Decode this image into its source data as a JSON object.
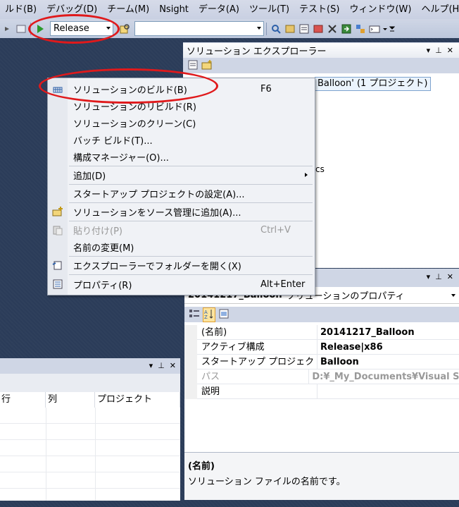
{
  "menubar": {
    "items": [
      "ルド(B)",
      "デバッグ(D)",
      "チーム(M)",
      "Nsight",
      "データ(A)",
      "ツール(T)",
      "テスト(S)",
      "ウィンドウ(W)",
      "ヘルプ(H)"
    ]
  },
  "toolbar": {
    "config_value": "Release",
    "platform_value": ""
  },
  "solution_explorer": {
    "title": "ソリューション エクスプローラー",
    "tree_node": "Balloon' (1 プロジェクト)",
    "tree_fragment": "cs"
  },
  "context_menu": {
    "items": [
      {
        "label": "ソリューションのビルド(B)",
        "shortcut": "F6",
        "icon": "build-icon"
      },
      {
        "label": "ソリューションのリビルド(R)",
        "shortcut": "",
        "icon": ""
      },
      {
        "label": "ソリューションのクリーン(C)",
        "shortcut": "",
        "icon": ""
      },
      {
        "label": "バッチ ビルド(T)...",
        "shortcut": "",
        "icon": ""
      },
      {
        "label": "構成マネージャー(O)...",
        "shortcut": "",
        "icon": ""
      },
      {
        "label": "追加(D)",
        "shortcut": "",
        "icon": ""
      },
      {
        "label": "スタートアップ プロジェクトの設定(A)...",
        "shortcut": "",
        "icon": ""
      },
      {
        "label": "ソリューションをソース管理に追加(A)...",
        "shortcut": "",
        "icon": "source-control-icon"
      },
      {
        "label": "貼り付け(P)",
        "shortcut": "Ctrl+V",
        "icon": "paste-icon"
      },
      {
        "label": "名前の変更(M)",
        "shortcut": "",
        "icon": ""
      },
      {
        "label": "エクスプローラーでフォルダーを開く(X)",
        "shortcut": "",
        "icon": "open-folder-icon"
      },
      {
        "label": "プロパティ(R)",
        "shortcut": "Alt+Enter",
        "icon": "properties-icon"
      }
    ]
  },
  "properties": {
    "object_name": "20141217_Balloon",
    "object_type": "ソリューションのプロパティ",
    "rows": [
      {
        "name": "(名前)",
        "value": "20141217_Balloon"
      },
      {
        "name": "アクティブ構成",
        "value": "Release|x86"
      },
      {
        "name": "スタートアップ プロジェクト",
        "value": "Balloon"
      },
      {
        "name": "パス",
        "value": "D:¥_My_Documents¥Visual Stu"
      },
      {
        "name": "説明",
        "value": ""
      }
    ],
    "desc_title": "(名前)",
    "desc_text": "ソリューション ファイルの名前です。"
  },
  "error_list": {
    "columns": [
      "行",
      "列",
      "プロジェクト"
    ]
  }
}
